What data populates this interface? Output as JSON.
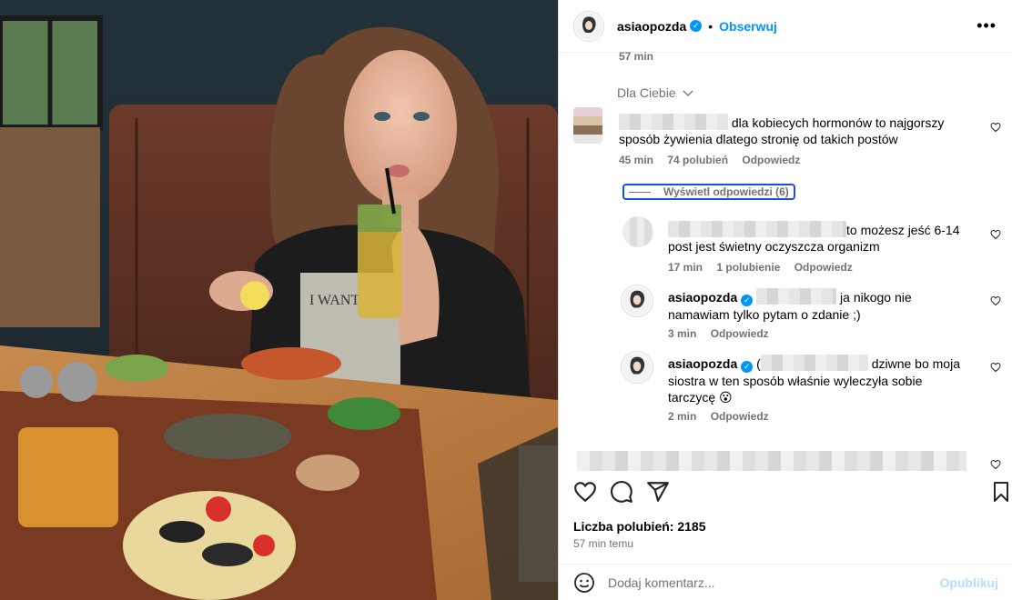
{
  "header": {
    "username": "asiaopozda",
    "follow_label": "Obserwuj"
  },
  "top_time": "57 min",
  "sort": {
    "label": "Dla Ciebie"
  },
  "comments": [
    {
      "text": "dla kobiecych hormonów to najgorszy sposób żywienia dlatego stronię od takich postów",
      "time": "45 min",
      "likes": "74 polubień",
      "reply": "Odpowiedz",
      "view_replies": "Wyświetl odpowiedzi (6)"
    }
  ],
  "replies": [
    {
      "text_a": "to możesz jeść 6-14",
      "text_b": "post jest świetny oczyszcza organizm",
      "time": "17 min",
      "likes": "1 polubienie",
      "reply": "Odpowiedz"
    },
    {
      "username": "asiaopozda",
      "text_a": "ja nikogo nie",
      "text_b": "namawiam tylko pytam o zdanie ;)",
      "time": "3 min",
      "reply": "Odpowiedz"
    },
    {
      "username": "asiaopozda",
      "prefix": "(",
      "text_a": "dziwne bo moja",
      "text_b": "siostra w ten sposób właśnie wyleczyła sobie",
      "text_c": "tarczycę 😮",
      "time": "2 min",
      "reply": "Odpowiedz"
    }
  ],
  "footer": {
    "likes": "Liczba polubień: 2185",
    "time": "57 min temu",
    "comment_placeholder": "Dodaj komentarz...",
    "publish": "Opublikuj"
  },
  "icons": {
    "heart": "heart-icon",
    "comment": "comment-icon",
    "share": "share-icon",
    "save": "bookmark-icon",
    "emoji": "emoji-icon",
    "more": "more-icon"
  },
  "colors": {
    "accent": "#0095f6",
    "muted": "#737373"
  }
}
